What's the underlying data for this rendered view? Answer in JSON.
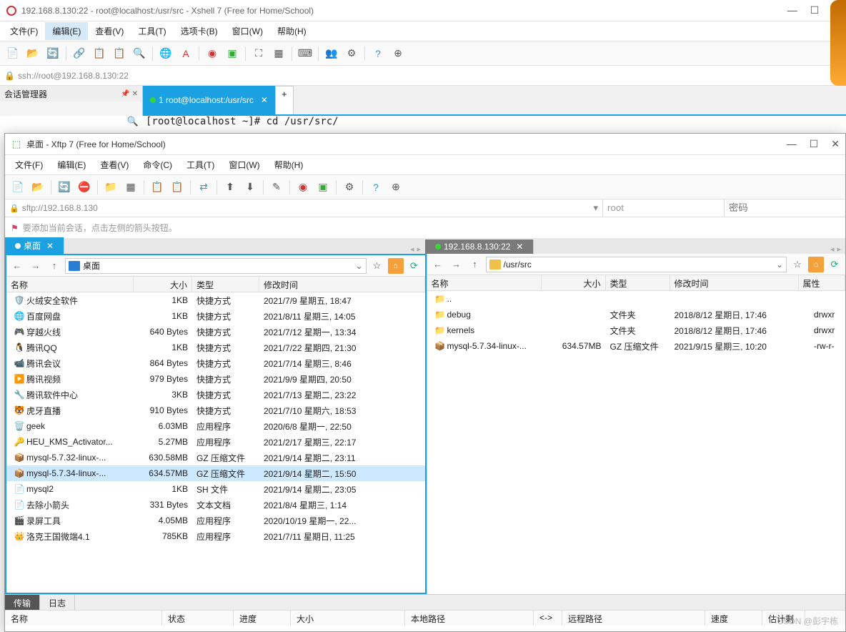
{
  "xshell": {
    "title": "192.168.8.130:22 - root@localhost:/usr/src - Xshell 7 (Free for Home/School)",
    "menus": [
      "文件(F)",
      "编辑(E)",
      "查看(V)",
      "工具(T)",
      "选项卡(B)",
      "窗口(W)",
      "帮助(H)"
    ],
    "menu_hl_index": 1,
    "address": "ssh://root@192.168.8.130:22",
    "sidebar_title": "会话管理器",
    "tab_label": "1 root@localhost:/usr/src",
    "prompt": "[root@localhost ~]# cd /usr/src/"
  },
  "xftp": {
    "title": "桌面 - Xftp 7 (Free for Home/School)",
    "menus": [
      "文件(F)",
      "编辑(E)",
      "查看(V)",
      "命令(C)",
      "工具(T)",
      "窗口(W)",
      "帮助(H)"
    ],
    "address": "sftp://192.168.8.130",
    "user_placeholder": "root",
    "pass_placeholder": "密码",
    "hint": "要添加当前会话，点击左侧的箭头按钮。",
    "local_tab": "桌面",
    "remote_tab": "192.168.8.130:22",
    "local_path": "桌面",
    "remote_path": "/usr/src",
    "headers": {
      "name": "名称",
      "size": "大小",
      "type": "类型",
      "mtime": "修改时间",
      "attr": "属性"
    },
    "local_files": [
      {
        "ico": "🛡️",
        "name": "火绒安全软件",
        "size": "1KB",
        "type": "快捷方式",
        "mtime": "2021/7/9 星期五, 18:47"
      },
      {
        "ico": "🌐",
        "name": "百度网盘",
        "size": "1KB",
        "type": "快捷方式",
        "mtime": "2021/8/11 星期三, 14:05"
      },
      {
        "ico": "🎮",
        "name": "穿越火线",
        "size": "640 Bytes",
        "type": "快捷方式",
        "mtime": "2021/7/12 星期一, 13:34"
      },
      {
        "ico": "🐧",
        "name": "腾讯QQ",
        "size": "1KB",
        "type": "快捷方式",
        "mtime": "2021/7/22 星期四, 21:30"
      },
      {
        "ico": "📹",
        "name": "腾讯会议",
        "size": "864 Bytes",
        "type": "快捷方式",
        "mtime": "2021/7/14 星期三, 8:46"
      },
      {
        "ico": "▶️",
        "name": "腾讯视频",
        "size": "979 Bytes",
        "type": "快捷方式",
        "mtime": "2021/9/9 星期四, 20:50"
      },
      {
        "ico": "🔧",
        "name": "腾讯软件中心",
        "size": "3KB",
        "type": "快捷方式",
        "mtime": "2021/7/13 星期二, 23:22"
      },
      {
        "ico": "🐯",
        "name": "虎牙直播",
        "size": "910 Bytes",
        "type": "快捷方式",
        "mtime": "2021/7/10 星期六, 18:53"
      },
      {
        "ico": "🗑️",
        "name": "geek",
        "size": "6.03MB",
        "type": "应用程序",
        "mtime": "2020/6/8 星期一, 22:50"
      },
      {
        "ico": "🔑",
        "name": "HEU_KMS_Activator...",
        "size": "5.27MB",
        "type": "应用程序",
        "mtime": "2021/2/17 星期三, 22:17"
      },
      {
        "ico": "📦",
        "name": "mysql-5.7.32-linux-...",
        "size": "630.58MB",
        "type": "GZ 压缩文件",
        "mtime": "2021/9/14 星期二, 23:11"
      },
      {
        "ico": "📦",
        "name": "mysql-5.7.34-linux-...",
        "size": "634.57MB",
        "type": "GZ 压缩文件",
        "mtime": "2021/9/14 星期二, 15:50",
        "selected": true
      },
      {
        "ico": "📄",
        "name": "mysql2",
        "size": "1KB",
        "type": "SH 文件",
        "mtime": "2021/9/14 星期二, 23:05"
      },
      {
        "ico": "📄",
        "name": "去除小箭头",
        "size": "331 Bytes",
        "type": "文本文档",
        "mtime": "2021/8/4 星期三, 1:14"
      },
      {
        "ico": "🎬",
        "name": "录屏工具",
        "size": "4.05MB",
        "type": "应用程序",
        "mtime": "2020/10/19 星期一, 22..."
      },
      {
        "ico": "👑",
        "name": "洛克王国微端4.1",
        "size": "785KB",
        "type": "应用程序",
        "mtime": "2021/7/11 星期日, 11:25"
      }
    ],
    "remote_files": [
      {
        "ico": "📁",
        "name": "..",
        "size": "",
        "type": "",
        "mtime": "",
        "attr": ""
      },
      {
        "ico": "📁",
        "name": "debug",
        "size": "",
        "type": "文件夹",
        "mtime": "2018/8/12 星期日, 17:46",
        "attr": "drwxr"
      },
      {
        "ico": "📁",
        "name": "kernels",
        "size": "",
        "type": "文件夹",
        "mtime": "2018/8/12 星期日, 17:46",
        "attr": "drwxr"
      },
      {
        "ico": "📦",
        "name": "mysql-5.7.34-linux-...",
        "size": "634.57MB",
        "type": "GZ 压缩文件",
        "mtime": "2021/9/15 星期三, 10:20",
        "attr": "-rw-r-"
      }
    ],
    "bottom_tabs": [
      "传输",
      "日志"
    ],
    "transfer_headers": [
      "名称",
      "状态",
      "进度",
      "大小",
      "本地路径",
      "<->",
      "远程路径",
      "速度",
      "估计剩"
    ],
    "watermark": "CSDN @彭宇栋"
  }
}
